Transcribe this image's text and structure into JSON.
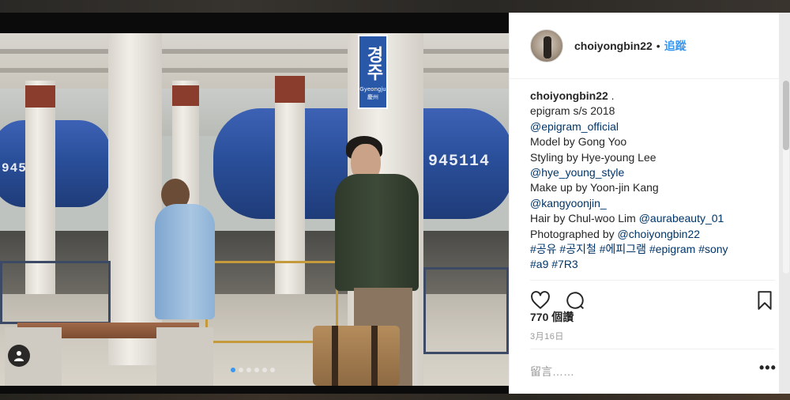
{
  "post": {
    "username": "choiyongbin22",
    "separator": "•",
    "follow_label": "追蹤",
    "caption_lines": [
      {
        "user": "choiyongbin22",
        "text": " ."
      },
      {
        "text": "epigram s/s 2018"
      },
      {
        "link": "@epigram_official"
      },
      {
        "text": "Model by Gong Yoo"
      },
      {
        "text": "Styling by Hye-young Lee"
      },
      {
        "link": "@hye_young_style"
      },
      {
        "text": "Make up by Yoon-jin Kang"
      },
      {
        "link": "@kangyoonjin_"
      },
      {
        "text": "Hair by Chul-woo Lim ",
        "link": "@aurabeauty_01"
      },
      {
        "text": "Photographed by ",
        "link": "@choiyongbin22"
      },
      {
        "link": "#공유 #공지철 #에피그램 #epigram #sony"
      },
      {
        "link": "#a9 #7R3"
      }
    ],
    "likes": "770 個讚",
    "date": "3月16日",
    "comment_placeholder": "留言……",
    "more_label": "•••"
  },
  "photo": {
    "sign_main": "경주",
    "sign_roman": "Gyeongju",
    "sign_small": "慶州",
    "tank_number_left": "945",
    "tank_number_right": "945114",
    "carousel_total": 6,
    "carousel_active": 0
  },
  "icons": {
    "like": "heart-icon",
    "comment": "comment-icon",
    "save": "bookmark-icon",
    "user_tag": "user-icon"
  },
  "colors": {
    "link": "#003569",
    "follow": "#3897f0",
    "text": "#262626",
    "muted": "#999999"
  }
}
